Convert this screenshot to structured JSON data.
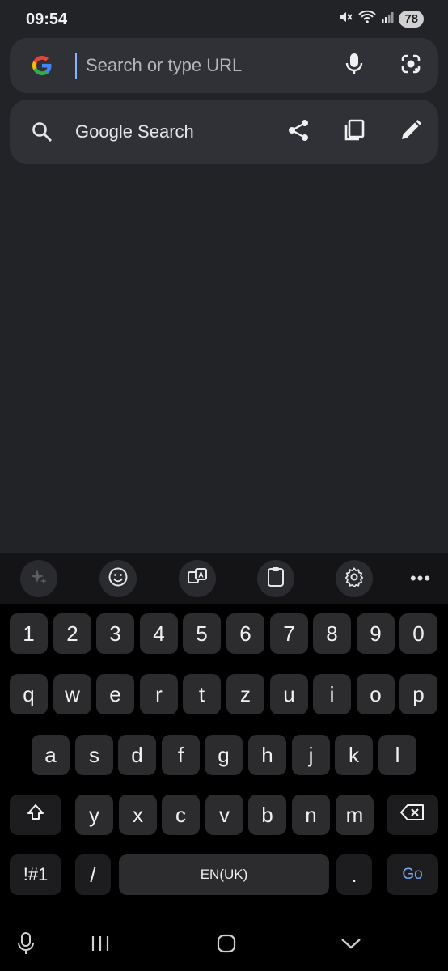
{
  "status_bar": {
    "time": "09:54",
    "battery": "78",
    "icons": [
      "mute-icon",
      "wifi-icon",
      "signal-icon"
    ]
  },
  "omnibox": {
    "placeholder": "Search or type URL",
    "value": "",
    "logo": "google-g-icon",
    "buttons": [
      "microphone-icon",
      "google-lens-icon"
    ]
  },
  "suggestion": {
    "label": "Google Search",
    "icon": "search-icon",
    "actions": [
      "share-icon",
      "copy-icon",
      "edit-icon"
    ]
  },
  "keyboard": {
    "toolbar": [
      "ai-sparkle-icon",
      "emoji-icon",
      "translate-icon",
      "clipboard-icon",
      "settings-icon",
      "more-icon"
    ],
    "more_label": "•••",
    "row_numbers": [
      "1",
      "2",
      "3",
      "4",
      "5",
      "6",
      "7",
      "8",
      "9",
      "0"
    ],
    "row_1": [
      "q",
      "w",
      "e",
      "r",
      "t",
      "z",
      "u",
      "i",
      "o",
      "p"
    ],
    "row_2": [
      "a",
      "s",
      "d",
      "f",
      "g",
      "h",
      "j",
      "k",
      "l"
    ],
    "row_3": [
      "y",
      "x",
      "c",
      "v",
      "b",
      "n",
      "m"
    ],
    "symbols_label": "!#1",
    "slash_label": "/",
    "space_label": "EN(UK)",
    "period_label": ".",
    "go_label": "Go"
  },
  "colors": {
    "background": "#222327",
    "surface": "#303136",
    "accent": "#8ab4f8",
    "go_text": "#7ea6f5"
  },
  "navbar": [
    "keyboard-mic-icon",
    "recent-apps-icon",
    "home-icon",
    "hide-keyboard-icon"
  ]
}
